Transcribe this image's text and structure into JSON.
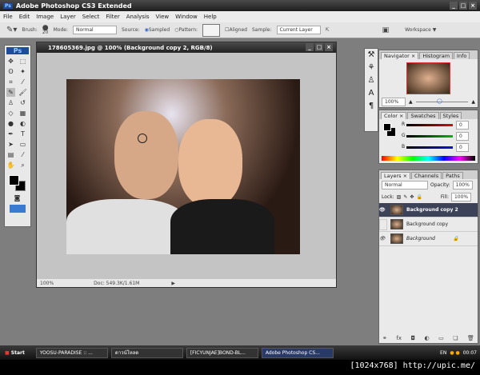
{
  "app": {
    "title": "Adobe Photoshop CS3 Extended",
    "ps_logo": "Ps"
  },
  "menu": [
    "File",
    "Edit",
    "Image",
    "Layer",
    "Select",
    "Filter",
    "Analysis",
    "View",
    "Window",
    "Help"
  ],
  "options": {
    "brush_label": "Brush:",
    "brush_size": "20",
    "mode_label": "Mode:",
    "mode_value": "Normal",
    "source_label": "Source:",
    "sampled": "Sampled",
    "pattern": "Pattern:",
    "aligned": "Aligned",
    "sample_label": "Sample:",
    "sample_value": "Current Layer",
    "workspace": "Workspace ▼"
  },
  "document": {
    "title": "178605369.jpg @ 100% (Background copy 2, RGB/8)",
    "zoom": "100%",
    "doc_info": "Doc: 549.3K/1.61M"
  },
  "navigator": {
    "tabs": [
      "Navigator ×",
      "Histogram",
      "Info"
    ],
    "zoom": "100%"
  },
  "color": {
    "tabs": [
      "Color ×",
      "Swatches",
      "Styles"
    ],
    "channels": [
      {
        "label": "R",
        "value": "0",
        "color": "#d01010"
      },
      {
        "label": "G",
        "value": "0",
        "color": "#10b010"
      },
      {
        "label": "B",
        "value": "0",
        "color": "#1010d0"
      }
    ]
  },
  "layers": {
    "tabs": [
      "Layers ×",
      "Channels",
      "Paths"
    ],
    "blend": "Normal",
    "opacity_label": "Opacity:",
    "opacity": "100%",
    "lock_label": "Lock:",
    "fill_label": "Fill:",
    "fill": "100%",
    "items": [
      {
        "name": "Background copy 2",
        "visible": true,
        "selected": true
      },
      {
        "name": "Background copy",
        "visible": false,
        "selected": false
      },
      {
        "name": "Background",
        "visible": true,
        "selected": false
      }
    ]
  },
  "taskbar": {
    "start": "Start",
    "tasks": [
      "YOOSU-PARADISE :: ...",
      "ดาวน์โหลด",
      "[FICYUNJAE]BOND-BL...",
      "Adobe Photoshop CS..."
    ],
    "lang": "EN",
    "clock": "00:07"
  },
  "watermark": "[1024x768] http://upic.me/"
}
